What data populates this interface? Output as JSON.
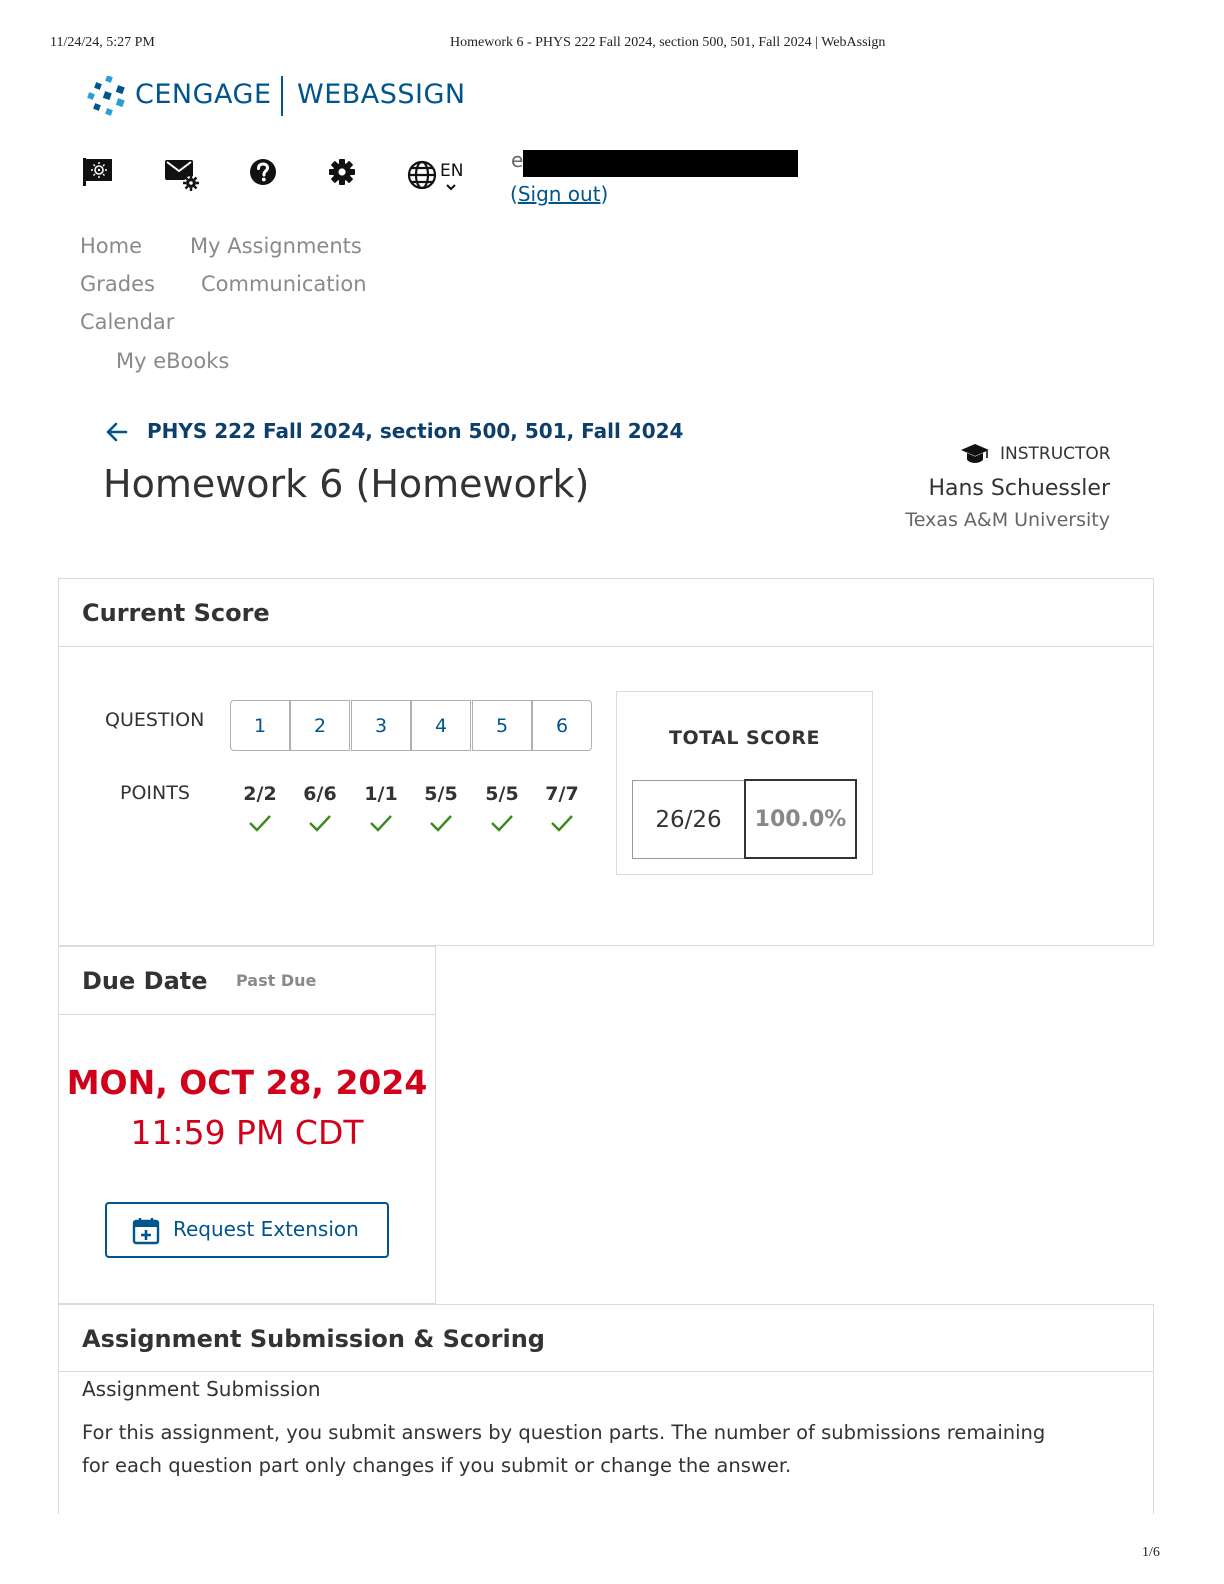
{
  "print_header": {
    "datetime": "11/24/24, 5:27 PM",
    "doc_title": "Homework 6 - PHYS 222 Fall 2024, section 500, 501, Fall 2024 | WebAssign",
    "page_number": "1/6"
  },
  "brand": {
    "left": "CENGAGE",
    "right": "WEBASSIGN",
    "accent": "#00558c",
    "logo_blue": "#2a9fd6"
  },
  "toolbar": {
    "icons": [
      "flag-icon",
      "mail-settings-icon",
      "help-icon",
      "gear-icon",
      "globe-icon"
    ],
    "language": "EN",
    "user_initial": "e",
    "sign_out_open": "(",
    "sign_out": "Sign out",
    "sign_out_close": ")"
  },
  "nav": {
    "home": "Home",
    "my_assignments": "My Assignments",
    "grades": "Grades",
    "communication": "Communication",
    "calendar": "Calendar",
    "my_ebooks": "My eBooks"
  },
  "course": {
    "back_link": "PHYS 222 Fall 2024, section 500, 501, Fall 2024",
    "assignment_title": "Homework 6 (Homework)"
  },
  "instructor": {
    "label": "INSTRUCTOR",
    "name": "Hans Schuessler",
    "school": "Texas A&M University"
  },
  "current_score": {
    "title": "Current Score",
    "question_label": "QUESTION",
    "points_label": "POINTS",
    "questions": [
      "1",
      "2",
      "3",
      "4",
      "5",
      "6"
    ],
    "points": [
      "2/2",
      "6/6",
      "1/1",
      "5/5",
      "5/5",
      "7/7"
    ],
    "total_label": "TOTAL SCORE",
    "total_points": "26/26",
    "total_percent": "100.0%",
    "check_color": "#3a8a1e"
  },
  "due_date": {
    "title": "Due Date",
    "status": "Past Due",
    "date": "MON, OCT 28, 2024",
    "time": "11:59 PM CDT",
    "date_color": "#d0021b",
    "extension_button": "Request Extension"
  },
  "submission": {
    "title": "Assignment Submission & Scoring",
    "subtitle": "Assignment Submission",
    "body_line1": "For this assignment, you submit answers by question parts. The number of submissions remaining",
    "body_line2": "for each question part only changes if you submit or change the answer."
  }
}
